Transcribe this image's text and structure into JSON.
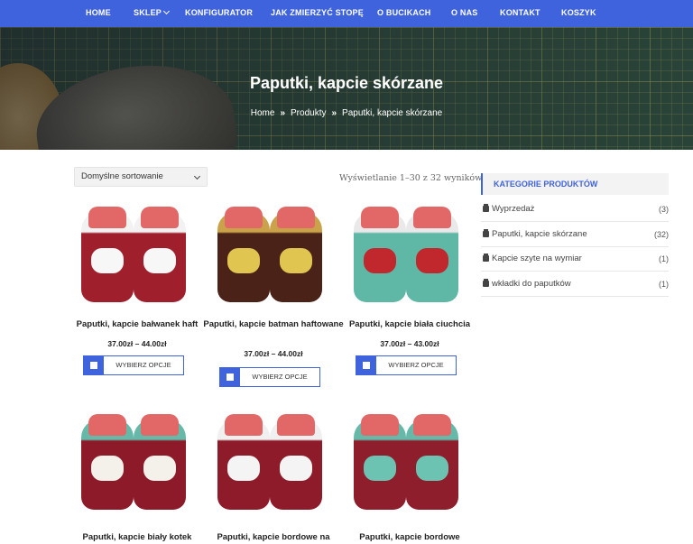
{
  "nav": {
    "items": [
      {
        "label": "HOME"
      },
      {
        "label": "SKLEP"
      },
      {
        "label": "KONFIGURATOR"
      },
      {
        "label": "JAK ZMIERZYĆ STOPĘ"
      },
      {
        "label": "O BUCIKACH"
      },
      {
        "label": "O NAS"
      },
      {
        "label": "KONTAKT"
      },
      {
        "label": "KOSZYK"
      }
    ]
  },
  "hero": {
    "title": "Paputki, kapcie skórzane",
    "breadcrumb": [
      "Home",
      "Produkty",
      "Paputki, kapcie skórzane"
    ],
    "separator": "»"
  },
  "shop": {
    "sort_value": "Domyślne sortowanie",
    "result_count": "Wyświetlanie 1–30 z 32 wyników",
    "button_label": "WYBIERZ OPCJE",
    "products": [
      {
        "name": "Paputki, kapcie bałwanek haft",
        "price": "37.00zł – 44.00zł",
        "color": "#a01f2c",
        "lining": "#f2f2f2",
        "deco": "#f7f7f7"
      },
      {
        "name": "Paputki, kapcie batman haftowane",
        "price": "37.00zł – 44.00zł",
        "color": "#4a2218",
        "lining": "#c9a24a",
        "deco": "#e0c651"
      },
      {
        "name": "Paputki, kapcie biała ciuchcia",
        "price": "37.00zł – 43.00zł",
        "color": "#5fb8a5",
        "lining": "#e9e9e9",
        "deco": "#c0282e"
      },
      {
        "name": "Paputki, kapcie biały kotek",
        "color": "#8c1a28",
        "lining": "#66b8a8",
        "deco": "#f4f0ea"
      },
      {
        "name": "Paputki, kapcie bordowe na",
        "color": "#8e1b2a",
        "lining": "#f0f0f0",
        "deco": "#f4f4f4"
      },
      {
        "name": "Paputki, kapcie bordowe",
        "color": "#8f1e2c",
        "lining": "#66b8a8",
        "deco": "#6cc3b2"
      }
    ]
  },
  "sidebar": {
    "heading": "KATEGORIE PRODUKTÓW",
    "categories": [
      {
        "label": "Wyprzedaż",
        "count": "(3)"
      },
      {
        "label": "Paputki, kapcie skórzane",
        "count": "(32)"
      },
      {
        "label": "Kapcie szyte na wymiar",
        "count": "(1)"
      },
      {
        "label": "wkładki do paputków",
        "count": "(1)"
      }
    ]
  },
  "colors": {
    "accent": "#3f63dd"
  }
}
